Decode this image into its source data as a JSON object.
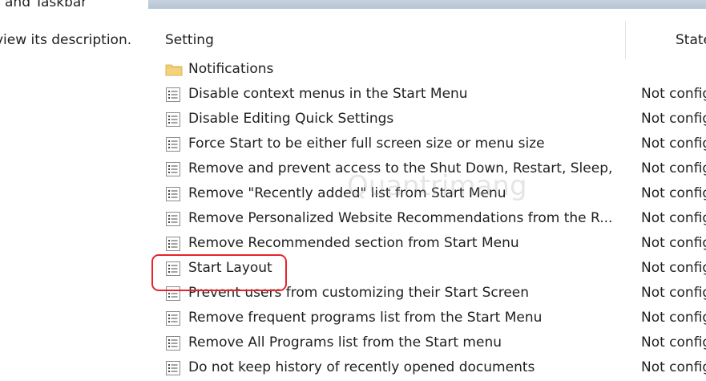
{
  "left_pane": {
    "header_fragment": "and Taskbar",
    "description_fragment": "view its description."
  },
  "columns": {
    "setting": "Setting",
    "state": "State"
  },
  "folder": {
    "label": "Notifications"
  },
  "rows": [
    {
      "label": "Disable context menus in the Start Menu",
      "state": "Not configured"
    },
    {
      "label": "Disable Editing Quick Settings",
      "state": "Not configured"
    },
    {
      "label": "Force Start to be either full screen size or menu size",
      "state": "Not configured"
    },
    {
      "label": "Remove and prevent access to the Shut Down, Restart, Sleep, ...",
      "state": "Not configured"
    },
    {
      "label": "Remove \"Recently added\" list from Start Menu",
      "state": "Not configured"
    },
    {
      "label": "Remove Personalized Website Recommendations from the R...",
      "state": "Not configured"
    },
    {
      "label": "Remove Recommended section from Start Menu",
      "state": "Not configured"
    },
    {
      "label": "Start Layout",
      "state": "Not configured"
    },
    {
      "label": "Prevent users from customizing their Start Screen",
      "state": "Not configured"
    },
    {
      "label": "Remove frequent programs list from the Start Menu",
      "state": "Not configured"
    },
    {
      "label": "Remove All Programs list from the Start menu",
      "state": "Not configured"
    },
    {
      "label": "Do not keep history of recently opened documents",
      "state": "Not configured"
    }
  ],
  "highlighted_row_index": 7,
  "watermark": "Quantrimang",
  "colors": {
    "highlight": "#e8242b",
    "folder": "#f3d27a",
    "top_band": "#b6c5d4"
  }
}
